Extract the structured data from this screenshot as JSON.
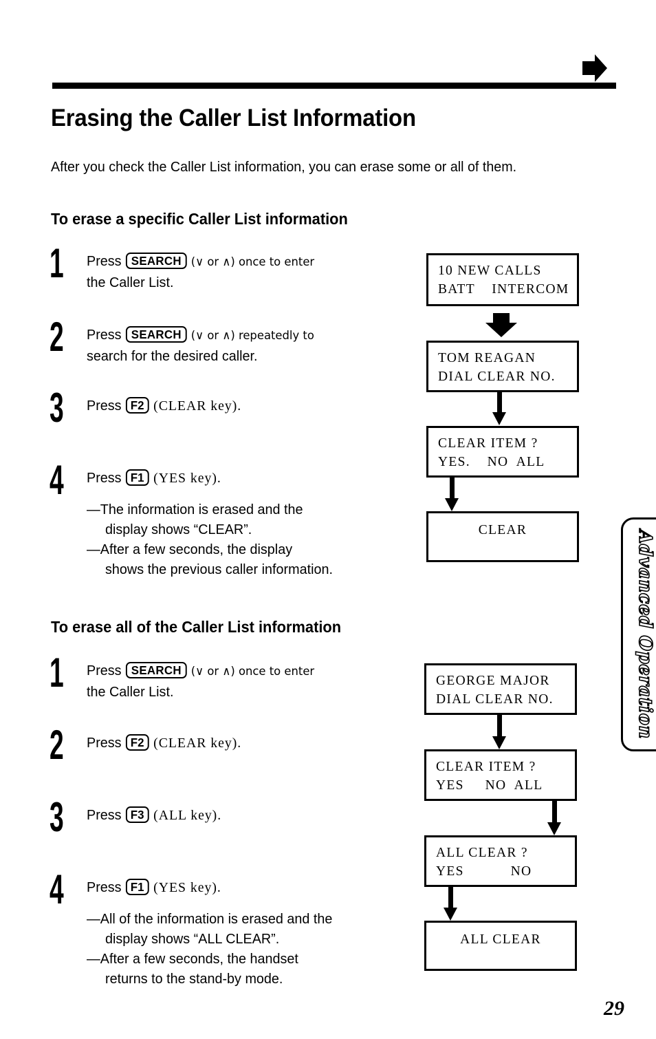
{
  "header": {
    "arrow_icon": "right-arrow-icon",
    "rule": true
  },
  "page_title": "Erasing the Caller List Information",
  "intro": "After you check the Caller List information, you can erase some or all of them.",
  "sections": [
    {
      "heading": "To erase a specific Caller List information",
      "steps": [
        {
          "number": "1",
          "line1_pre": "Press ",
          "key": "SEARCH",
          "line1_post": " (∨ or ∧) once to enter",
          "line2": "the Caller List."
        },
        {
          "number": "2",
          "line1_pre": "Press ",
          "key": "SEARCH",
          "line1_post": " (∨ or ∧) repeatedly to",
          "line2": "search for the desired caller."
        },
        {
          "number": "3",
          "line1_pre": "Press ",
          "key": "F2",
          "line1_post": " (CLEAR key)."
        },
        {
          "number": "4",
          "line1_pre": "Press ",
          "key": "F1",
          "line1_post": " (YES key).",
          "notes": [
            {
              "a": "—The information is erased and the",
              "b": "display shows “CLEAR”."
            },
            {
              "a": "—After a few seconds, the display",
              "b": "shows the previous caller information."
            }
          ]
        }
      ],
      "flow": [
        {
          "type": "screen",
          "line1": "10 NEW CALLS",
          "line2": "BATT    INTERCOM"
        },
        {
          "type": "arrow",
          "style": "fat"
        },
        {
          "type": "screen",
          "line1": "TOM REAGAN",
          "line2": "DIAL CLEAR NO."
        },
        {
          "type": "arrow",
          "style": "thin"
        },
        {
          "type": "screen",
          "line1": "CLEAR ITEM ?",
          "line2": "YES.    NO  ALL"
        },
        {
          "type": "arrow",
          "style": "thin"
        },
        {
          "type": "screen",
          "centered": "CLEAR"
        }
      ]
    },
    {
      "heading": "To erase all of the Caller List information",
      "steps": [
        {
          "number": "1",
          "line1_pre": "Press ",
          "key": "SEARCH",
          "line1_post": " (∨ or ∧) once to enter",
          "line2": "the Caller List."
        },
        {
          "number": "2",
          "line1_pre": "Press ",
          "key": "F2",
          "line1_post": " (CLEAR key)."
        },
        {
          "number": "3",
          "line1_pre": "Press ",
          "key": "F3",
          "line1_post": " (ALL key)."
        },
        {
          "number": "4",
          "line1_pre": "Press ",
          "key": "F1",
          "line1_post": " (YES key).",
          "notes": [
            {
              "a": "—All of the information is erased and the",
              "b": "display shows “ALL CLEAR”."
            },
            {
              "a": "—After a few seconds, the handset",
              "b": "returns to the stand-by mode."
            }
          ]
        }
      ],
      "flow": [
        {
          "type": "screen",
          "line1": "GEORGE MAJOR",
          "line2": "DIAL CLEAR NO."
        },
        {
          "type": "arrow",
          "style": "thin"
        },
        {
          "type": "screen",
          "line1": "CLEAR ITEM ?",
          "line2": "YES     NO  ALL"
        },
        {
          "type": "arrow",
          "style": "thin"
        },
        {
          "type": "screen",
          "line1": "ALL CLEAR ?",
          "line2": "YES           NO"
        },
        {
          "type": "arrow",
          "style": "thin"
        },
        {
          "type": "screen",
          "centered": "ALL CLEAR"
        }
      ]
    }
  ],
  "side_tab": {
    "label": "Advanced Operation"
  },
  "page_number": "29"
}
